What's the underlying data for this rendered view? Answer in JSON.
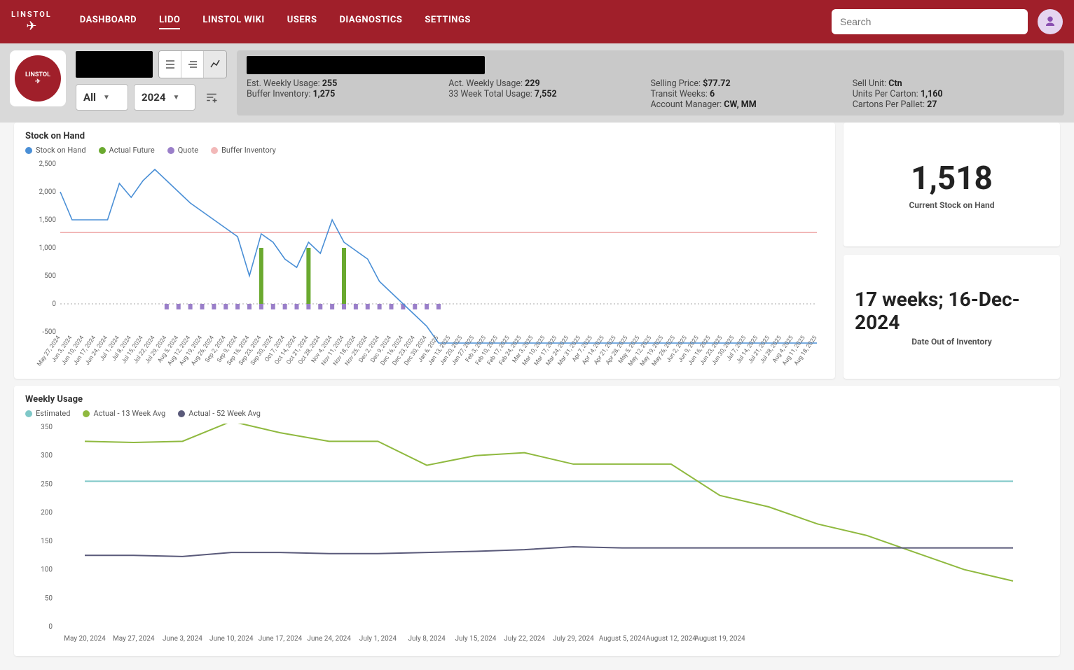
{
  "nav": {
    "items": [
      "DASHBOARD",
      "LIDO",
      "LINSTOL WIKI",
      "USERS",
      "DIAGNOSTICS",
      "SETTINGS"
    ],
    "active": 1
  },
  "search": {
    "placeholder": "Search"
  },
  "logo": {
    "text": "LINSTOL"
  },
  "selects": {
    "filter": "All",
    "year": "2024"
  },
  "info": {
    "row1": [
      {
        "label": "Est. Weekly Usage:",
        "value": "255"
      },
      {
        "label": "Act. Weekly Usage:",
        "value": "229"
      },
      {
        "label": "Selling Price:",
        "value": "$77.72"
      },
      {
        "label": "Sell Unit:",
        "value": "Ctn"
      }
    ],
    "row2": [
      {
        "label": "Buffer Inventory:",
        "value": "1,275"
      },
      {
        "label": "33 Week Total Usage:",
        "value": "7,552"
      },
      {
        "label": "Transit Weeks:",
        "value": "6"
      },
      {
        "label": "Units Per Carton:",
        "value": "1,160"
      }
    ],
    "row3": [
      {
        "label": "",
        "value": ""
      },
      {
        "label": "",
        "value": ""
      },
      {
        "label": "Account Manager:",
        "value": "CW, MM"
      },
      {
        "label": "Cartons Per Pallet:",
        "value": "27"
      }
    ]
  },
  "kpi": {
    "stock": {
      "value": "1,518",
      "label": "Current Stock on Hand"
    },
    "outdate": {
      "value": "17 weeks; 16-Dec-2024",
      "label": "Date Out of Inventory"
    }
  },
  "chart1": {
    "title": "Stock on Hand",
    "legend": [
      {
        "name": "Stock on Hand",
        "color": "#4a8fd6"
      },
      {
        "name": "Actual Future",
        "color": "#6aa92f"
      },
      {
        "name": "Quote",
        "color": "#9a7fc9"
      },
      {
        "name": "Buffer Inventory",
        "color": "#f2b8b8"
      }
    ]
  },
  "chart2": {
    "title": "Weekly Usage",
    "legend": [
      {
        "name": "Estimated",
        "color": "#7fc8c8"
      },
      {
        "name": "Actual - 13 Week Avg",
        "color": "#8fb93f"
      },
      {
        "name": "Actual - 52 Week Avg",
        "color": "#5a5a7a"
      }
    ]
  },
  "chart_data": [
    {
      "type": "line",
      "title": "Stock on Hand",
      "ylim": [
        -500,
        2500
      ],
      "yticks": [
        -500,
        0,
        500,
        1000,
        1500,
        2000,
        2500
      ],
      "buffer_inventory": 1275,
      "categories": [
        "May 27, 2024",
        "Jun 3, 2024",
        "Jun 10, 2024",
        "Jun 17, 2024",
        "Jun 24, 2024",
        "Jul 1, 2024",
        "Jul 8, 2024",
        "Jul 15, 2024",
        "Jul 22, 2024",
        "Jul 29, 2024",
        "Aug 5, 2024",
        "Aug 12, 2024",
        "Aug 19, 2024",
        "Aug 26, 2024",
        "Sep 2, 2024",
        "Sep 9, 2024",
        "Sep 16, 2024",
        "Sep 23, 2024",
        "Sep 30, 2024",
        "Oct 7, 2024",
        "Oct 14, 2024",
        "Oct 21, 2024",
        "Oct 28, 2024",
        "Nov 4, 2024",
        "Nov 11, 2024",
        "Nov 18, 2024",
        "Nov 25, 2024",
        "Dec 2, 2024",
        "Dec 9, 2024",
        "Dec 16, 2024",
        "Dec 23, 2024",
        "Dec 30, 2024",
        "Jan 6, 2025",
        "Jan 13, 2025",
        "Jan 20, 2025",
        "Jan 27, 2025",
        "Feb 3, 2025",
        "Feb 10, 2025",
        "Feb 17, 2025",
        "Feb 24, 2025",
        "Mar 3, 2025",
        "Mar 10, 2025",
        "Mar 17, 2025",
        "Mar 24, 2025",
        "Mar 31, 2025",
        "Apr 7, 2025",
        "Apr 14, 2025",
        "Apr 21, 2025",
        "Apr 28, 2025",
        "May 5, 2025",
        "May 12, 2025",
        "May 19, 2025",
        "May 26, 2025",
        "Jun 2, 2025",
        "Jun 9, 2025",
        "Jun 16, 2025",
        "Jun 23, 2025",
        "Jun 30, 2025",
        "Jul 7, 2025",
        "Jul 14, 2025",
        "Jul 21, 2025",
        "Jul 28, 2025",
        "Aug 4, 2025",
        "Aug 11, 2025",
        "Aug 18, 2025"
      ],
      "series": [
        {
          "name": "Stock on Hand",
          "values": [
            2000,
            1500,
            1500,
            1500,
            1500,
            2150,
            1900,
            2200,
            2400,
            2200,
            2000,
            1800,
            1650,
            1500,
            1350,
            1200,
            500,
            1250,
            1100,
            800,
            650,
            1100,
            900,
            1500,
            1100,
            950,
            800,
            400,
            200,
            0,
            -200,
            -400,
            -700,
            -700,
            -700,
            -700,
            -700,
            -700,
            -700,
            -700,
            -700,
            -700,
            -700,
            -700,
            -700,
            -700,
            -700,
            -700,
            -700,
            -700,
            -700,
            -700,
            -700,
            -700,
            -700,
            -700,
            -700,
            -700,
            -700,
            -700,
            -700,
            -700,
            -700,
            -700,
            -700
          ]
        },
        {
          "name": "Actual Future",
          "type": "bar",
          "values": [
            0,
            0,
            0,
            0,
            0,
            0,
            0,
            0,
            0,
            0,
            0,
            0,
            0,
            0,
            0,
            0,
            0,
            1000,
            0,
            0,
            0,
            1000,
            0,
            0,
            1000,
            0,
            0,
            0,
            0,
            0,
            0,
            0,
            0,
            0,
            0,
            0,
            0,
            0,
            0,
            0,
            0,
            0,
            0,
            0,
            0,
            0,
            0,
            0,
            0,
            0,
            0,
            0,
            0,
            0,
            0,
            0,
            0,
            0,
            0,
            0,
            0,
            0,
            0,
            0,
            0
          ]
        },
        {
          "name": "Quote",
          "type": "bar",
          "values": [
            0,
            0,
            0,
            0,
            0,
            0,
            0,
            0,
            0,
            -100,
            -100,
            -100,
            -100,
            -100,
            -100,
            -100,
            -100,
            -100,
            -100,
            -100,
            -100,
            -100,
            -100,
            -100,
            -100,
            -100,
            -100,
            -100,
            -100,
            -100,
            -100,
            -100,
            -100,
            0,
            0,
            0,
            0,
            0,
            0,
            0,
            0,
            0,
            0,
            0,
            0,
            0,
            0,
            0,
            0,
            0,
            0,
            0,
            0,
            0,
            0,
            0,
            0,
            0,
            0,
            0,
            0,
            0,
            0,
            0,
            0
          ]
        }
      ]
    },
    {
      "type": "line",
      "title": "Weekly Usage",
      "ylim": [
        0,
        350
      ],
      "yticks": [
        0,
        50,
        100,
        150,
        200,
        250,
        300,
        350
      ],
      "categories": [
        "May 20, 2024",
        "May 27, 2024",
        "June 3, 2024",
        "June 10, 2024",
        "June 17, 2024",
        "June 24, 2024",
        "July 1, 2024",
        "July 8, 2024",
        "July 15, 2024",
        "July 22, 2024",
        "July 29, 2024",
        "August 5, 2024",
        "August 12, 2024",
        "August 19, 2024"
      ],
      "series": [
        {
          "name": "Estimated",
          "values": [
            255,
            255,
            255,
            255,
            255,
            255,
            255,
            255,
            255,
            255,
            255,
            255,
            255,
            255
          ]
        },
        {
          "name": "Actual - 13 Week Avg",
          "values": [
            325,
            323,
            325,
            360,
            340,
            325,
            325,
            283,
            300,
            305,
            285,
            285,
            285,
            230
          ]
        },
        {
          "name": "Actual - 52 Week Avg",
          "values": [
            125,
            125,
            123,
            130,
            130,
            128,
            128,
            130,
            132,
            135,
            140,
            138,
            138,
            138
          ]
        }
      ],
      "extra_tail": {
        "Actual - 13 Week Avg": [
          210,
          180,
          160,
          130,
          100,
          80
        ],
        "Actual - 52 Week Avg": [
          138,
          138,
          138,
          138,
          138,
          138
        ],
        "Estimated": [
          255,
          255,
          255,
          255,
          255,
          255
        ]
      }
    }
  ],
  "colors": {
    "brand": "#a01f2a",
    "stock": "#4a8fd6",
    "future": "#6aa92f",
    "quote": "#9a7fc9",
    "buffer": "#f2b8b8",
    "estimated": "#7fc8c8",
    "avg13": "#8fb93f",
    "avg52": "#5a5a7a"
  }
}
